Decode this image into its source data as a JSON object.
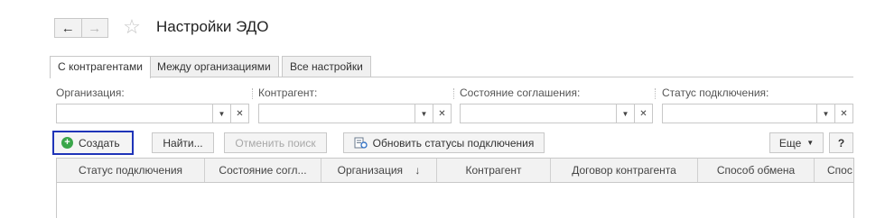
{
  "header": {
    "title": "Настройки ЭДО",
    "back_icon": "←",
    "forward_icon": "→",
    "favorite_icon": "☆"
  },
  "tabs": [
    {
      "label": "С контрагентами",
      "active": true
    },
    {
      "label": "Между организациями",
      "active": false
    },
    {
      "label": "Все настройки",
      "active": false
    }
  ],
  "filters": [
    {
      "label": "Организация:",
      "value": ""
    },
    {
      "label": "Контрагент:",
      "value": ""
    },
    {
      "label": "Состояние соглашения:",
      "value": ""
    },
    {
      "label": "Статус подключения:",
      "value": ""
    }
  ],
  "toolbar": {
    "create_label": "Создать",
    "find_label": "Найти...",
    "cancel_search_label": "Отменить поиск",
    "refresh_label": "Обновить статусы подключения",
    "more_label": "Еще",
    "help_label": "?"
  },
  "table": {
    "columns": [
      "Статус подключения",
      "Состояние согл...",
      "Организация",
      "Контрагент",
      "Договор контрагента",
      "Способ обмена",
      "Спос"
    ],
    "sort_indicator": "↓"
  },
  "colors": {
    "create_highlight": "#1f34b8",
    "create_icon": "#3aa64a"
  }
}
